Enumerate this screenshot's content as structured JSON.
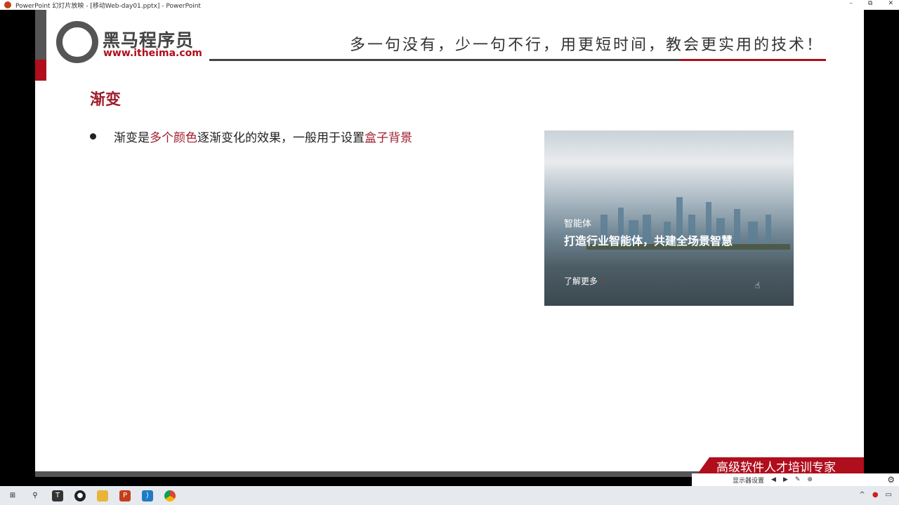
{
  "window": {
    "title": "PowerPoint 幻灯片放映 - [移动Web-day01.pptx] - PowerPoint",
    "min": "–",
    "max": "⧉",
    "close": "✕"
  },
  "header": {
    "logo_cn": "黑马程序员",
    "logo_url": "www.itheima.com",
    "slogan": "多一句没有，少一句不行，用更短时间，教会更实用的技术！"
  },
  "slide": {
    "heading": "渐变",
    "bullet": {
      "p1": "渐变是",
      "h1": "多个颜色",
      "p2": "逐渐变化的效果，一般用于设置",
      "h2": "盒子背景"
    }
  },
  "card": {
    "subtitle": "智能体",
    "title": "打造行业智能体，共建全场景智慧",
    "link": "了解更多",
    "arrow": "›"
  },
  "footer": {
    "banner": "高级软件人才培训专家",
    "tools": "显示器设置"
  },
  "colors": {
    "accent": "#b00d1d",
    "text_highlight": "#a01c2c"
  }
}
